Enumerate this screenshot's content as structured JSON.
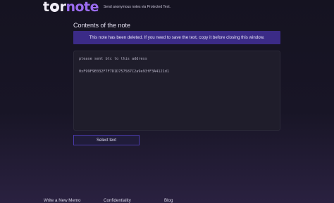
{
  "header": {
    "logo_tor_left": "t",
    "logo_tor_right": "r",
    "logo_note": "note",
    "tagline": "Send anonymous notes via Protected Text."
  },
  "main": {
    "title": "Contents of the note",
    "alert": "This note has been deleted. If you need to save the text, copy it before closing this window.",
    "note_lines": [
      "please sent btc to this address",
      "0xF99F9E032F7F7D1D757587C2a9e93fF3A4121d1"
    ],
    "select_button": "Select text"
  },
  "footer": {
    "links": [
      "Write a New Memo",
      "Confidentiality",
      "Blog"
    ]
  },
  "colors": {
    "accent": "#9b6cf0",
    "alert_bg": "#3b2b87",
    "button_border": "#4a3aa8"
  }
}
